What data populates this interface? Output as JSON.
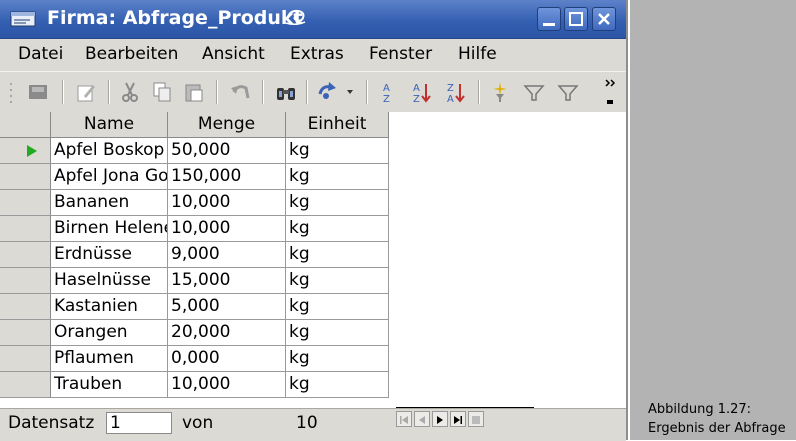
{
  "window": {
    "title": "Firma: Abfrage_Produkt"
  },
  "menu": [
    "Datei",
    "Bearbeiten",
    "Ansicht",
    "Extras",
    "Fenster",
    "Hilfe"
  ],
  "table": {
    "columns": [
      "Name",
      "Menge",
      "Einheit"
    ],
    "rows": [
      [
        "Apfel Boskop",
        "50,000",
        "kg"
      ],
      [
        "Apfel Jona Gold",
        "150,000",
        "kg"
      ],
      [
        "Bananen",
        "10,000",
        "kg"
      ],
      [
        "Birnen Helene",
        "10,000",
        "kg"
      ],
      [
        "Erdnüsse",
        "9,000",
        "kg"
      ],
      [
        "Haselnüsse",
        "15,000",
        "kg"
      ],
      [
        "Kastanien",
        "5,000",
        "kg"
      ],
      [
        "Orangen",
        "20,000",
        "kg"
      ],
      [
        "Pflaumen",
        "0,000",
        "kg"
      ],
      [
        "Trauben",
        "10,000",
        "kg"
      ]
    ]
  },
  "status": {
    "label": "Datensatz",
    "current": "1",
    "of_label": "von",
    "total": "10"
  },
  "caption": {
    "line1": "Abbildung 1.27:",
    "line2": "Ergebnis der Abfrage"
  }
}
